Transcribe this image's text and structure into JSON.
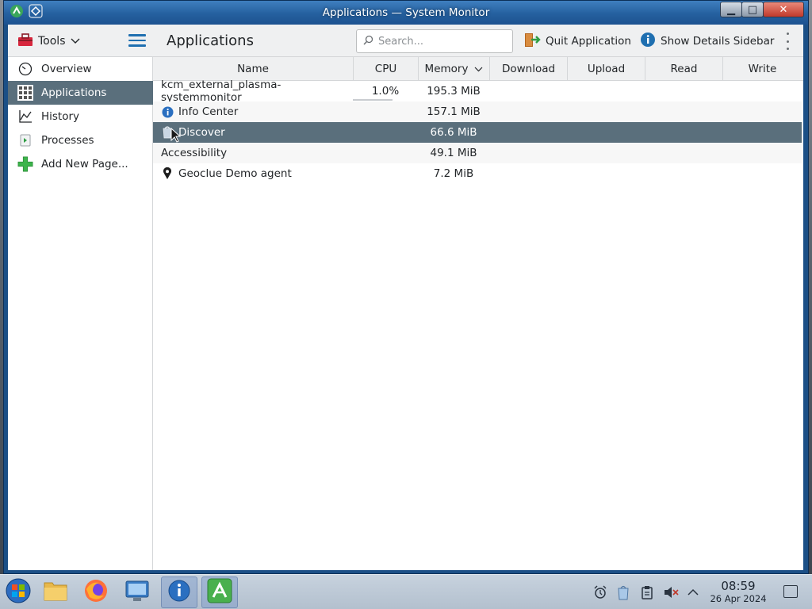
{
  "window": {
    "title": "Applications — System Monitor",
    "min_symbol": "▁",
    "max_symbol": "□",
    "close_symbol": "✕"
  },
  "toolbar": {
    "tools_label": "Tools",
    "page_title": "Applications",
    "search_placeholder": "Search...",
    "quit_label": "Quit Application",
    "details_label": "Show Details Sidebar"
  },
  "sidebar": {
    "items": [
      {
        "label": "Overview",
        "icon": "speedometer-icon"
      },
      {
        "label": "Applications",
        "icon": "applications-grid-icon"
      },
      {
        "label": "History",
        "icon": "chart-line-icon"
      },
      {
        "label": "Processes",
        "icon": "terminal-icon"
      },
      {
        "label": "Add New Page...",
        "icon": "plus-icon"
      }
    ]
  },
  "table": {
    "columns": [
      "Name",
      "CPU",
      "Memory",
      "Download",
      "Upload",
      "Read",
      "Write"
    ],
    "sort_indicator": "Memory",
    "rows": [
      {
        "name": "kcm_external_plasma-systemmonitor",
        "cpu": "1.0%",
        "memory": "195.3 MiB",
        "icon": ""
      },
      {
        "name": "Info Center",
        "cpu": "",
        "memory": "157.1 MiB",
        "icon": "info-icon"
      },
      {
        "name": "Discover",
        "cpu": "",
        "memory": "66.6 MiB",
        "icon": "discover-icon"
      },
      {
        "name": "Accessibility",
        "cpu": "",
        "memory": "49.1 MiB",
        "icon": ""
      },
      {
        "name": "Geoclue Demo agent",
        "cpu": "",
        "memory": "7.2 MiB",
        "icon": "location-pin-icon"
      }
    ],
    "selected_row": "Discover"
  },
  "taskbar": {
    "apps": [
      "start-orb-icon",
      "file-manager-icon",
      "firefox-icon",
      "system-settings-icon",
      "info-center-icon",
      "system-monitor-icon"
    ],
    "clock_time": "08:59",
    "clock_date": "26 Apr 2024"
  },
  "colors": {
    "selection": "#5a6f7c",
    "accent": "#1f6fb0",
    "titlebar": "#25609f"
  }
}
